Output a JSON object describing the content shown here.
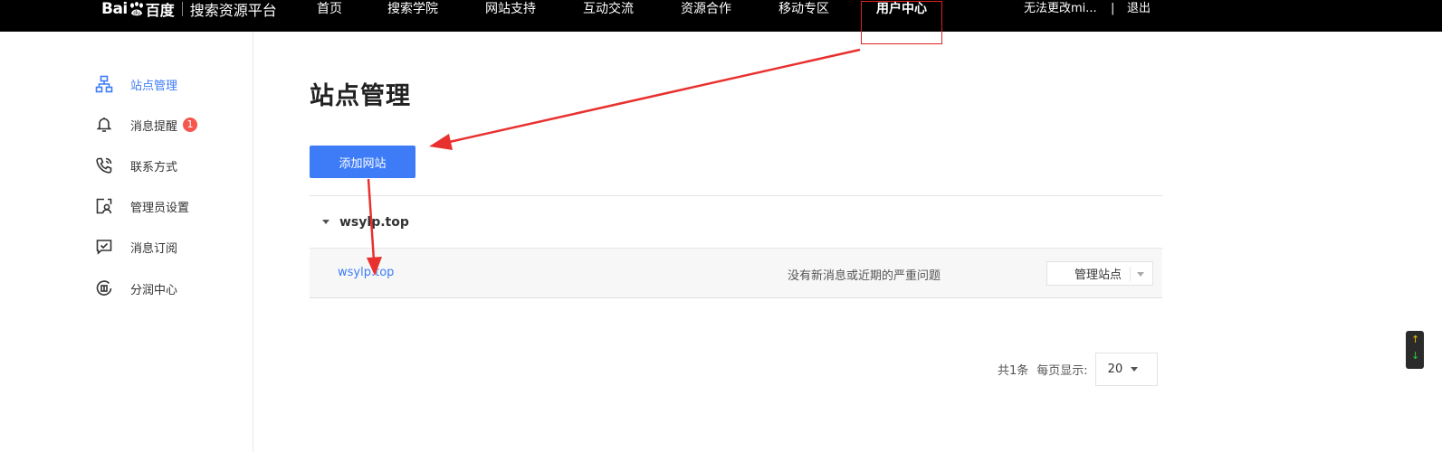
{
  "header": {
    "logo_bai": "Bai",
    "logo_baidu": "百度",
    "platform": "搜索资源平台",
    "nav": [
      {
        "label": "首页",
        "active": false
      },
      {
        "label": "搜索学院",
        "active": false
      },
      {
        "label": "网站支持",
        "active": false
      },
      {
        "label": "互动交流",
        "active": false
      },
      {
        "label": "资源合作",
        "active": false
      },
      {
        "label": "移动专区",
        "active": false
      },
      {
        "label": "用户中心",
        "active": true
      }
    ],
    "username": "无法更改mi...",
    "separator": "|",
    "logout": "退出"
  },
  "sidebar": {
    "items": [
      {
        "label": "站点管理",
        "icon": "sitemap-icon",
        "active": true
      },
      {
        "label": "消息提醒",
        "icon": "bell-icon",
        "badge": "1"
      },
      {
        "label": "联系方式",
        "icon": "phone-icon"
      },
      {
        "label": "管理员设置",
        "icon": "admin-settings-icon"
      },
      {
        "label": "消息订阅",
        "icon": "subscribe-icon"
      },
      {
        "label": "分润中心",
        "icon": "revenue-share-icon"
      }
    ]
  },
  "main": {
    "title": "站点管理",
    "add_button": "添加网站",
    "group": {
      "name": "wsylp.top"
    },
    "row": {
      "site": "wsylp.top",
      "message": "没有新消息或近期的严重问题",
      "manage": "管理站点"
    },
    "pager": {
      "total": "共1条",
      "per_page_label": "每页显示:",
      "per_page_value": "20"
    }
  },
  "colors": {
    "accent": "#3d7bf7",
    "badge": "#f5574c",
    "annotation": "#e8312f"
  }
}
